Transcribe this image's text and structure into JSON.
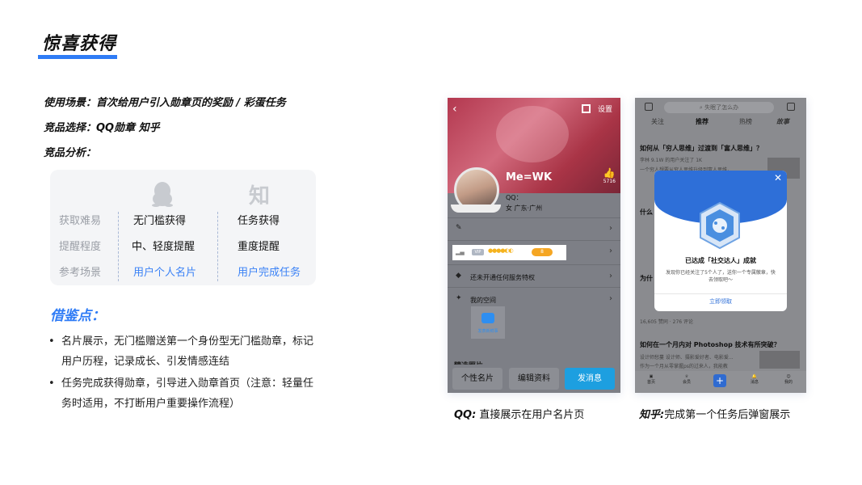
{
  "title": "惊喜获得",
  "usage": "使用场景：首次给用户引入勋章页的奖励 / 彩蛋任务",
  "competitors": "竞品选择：QQ勋章  知乎",
  "analysis": "竞品分析：",
  "compare": {
    "zhihu_logo": "知",
    "rows": [
      {
        "label": "获取难易",
        "qq": "无门槛获得",
        "zhihu": "任务获得"
      },
      {
        "label": "提醒程度",
        "qq": "中、轻度提醒",
        "zhihu": "重度提醒"
      },
      {
        "label": "参考场景",
        "qq": "用户个人名片",
        "zhihu": "用户完成任务"
      }
    ]
  },
  "lessons": {
    "heading": "借鉴点：",
    "items": [
      "名片展示，无门槛赠送第一个身份型无门槛勋章，标记用户历程，记录成长、引发情感连结",
      "任务完成获得勋章，引导进入勋章首页（注意：轻量任务时适用，不打断用户重要操作流程）"
    ]
  },
  "qq_screen": {
    "settings": "设置",
    "name": "Me=WK",
    "likes": "5716",
    "qq_label": "QQ：",
    "gender_location": "女  广东·广州",
    "vip": "VIP",
    "rows": [
      "还未开通任何服务特权",
      "我的空间"
    ],
    "space_tile": "发表新鲜事",
    "partial": "精选照片",
    "buttons": [
      "个性名片",
      "编辑资料",
      "发消息"
    ]
  },
  "zhihu_screen": {
    "search": "失眠了怎么办",
    "tabs": [
      "关注",
      "推荐",
      "热榜",
      "故事"
    ],
    "q1": "如何从「穷人思维」过渡到「富人思维」？",
    "q1_meta": "李林  9.1W 的用户关注了 1K",
    "q1_body": "一个穷人想要从穷人思维升级到富人思维，",
    "q2": "什么",
    "q3": "为什",
    "q3_meta": "16,605 赞同 · 276 评论",
    "q4": "如何在一个月内对 Photoshop 技术有所突破？",
    "q4_meta": "设计师愁蔓 设计师、摄影爱好者、电影爱...",
    "q4_body": "作为一个月从零掌握ps的过来人，我能教",
    "nav": [
      "首页",
      "会员",
      "",
      "消息",
      "我的"
    ]
  },
  "modal": {
    "title": "已达成「社交达人」成就",
    "desc": "发现你已经关注了5个人了，送你一个专属徽章，快去领取吧～",
    "cta": "立即领取"
  },
  "captions": {
    "qq_brand": "QQ:",
    "qq_text": "直接展示在用户名片页",
    "zhihu_brand": "知乎:",
    "zhihu_text": "完成第一个任务后弹窗展示"
  },
  "colors": {
    "accent": "#2f7cf6",
    "link": "#3b82f6"
  }
}
